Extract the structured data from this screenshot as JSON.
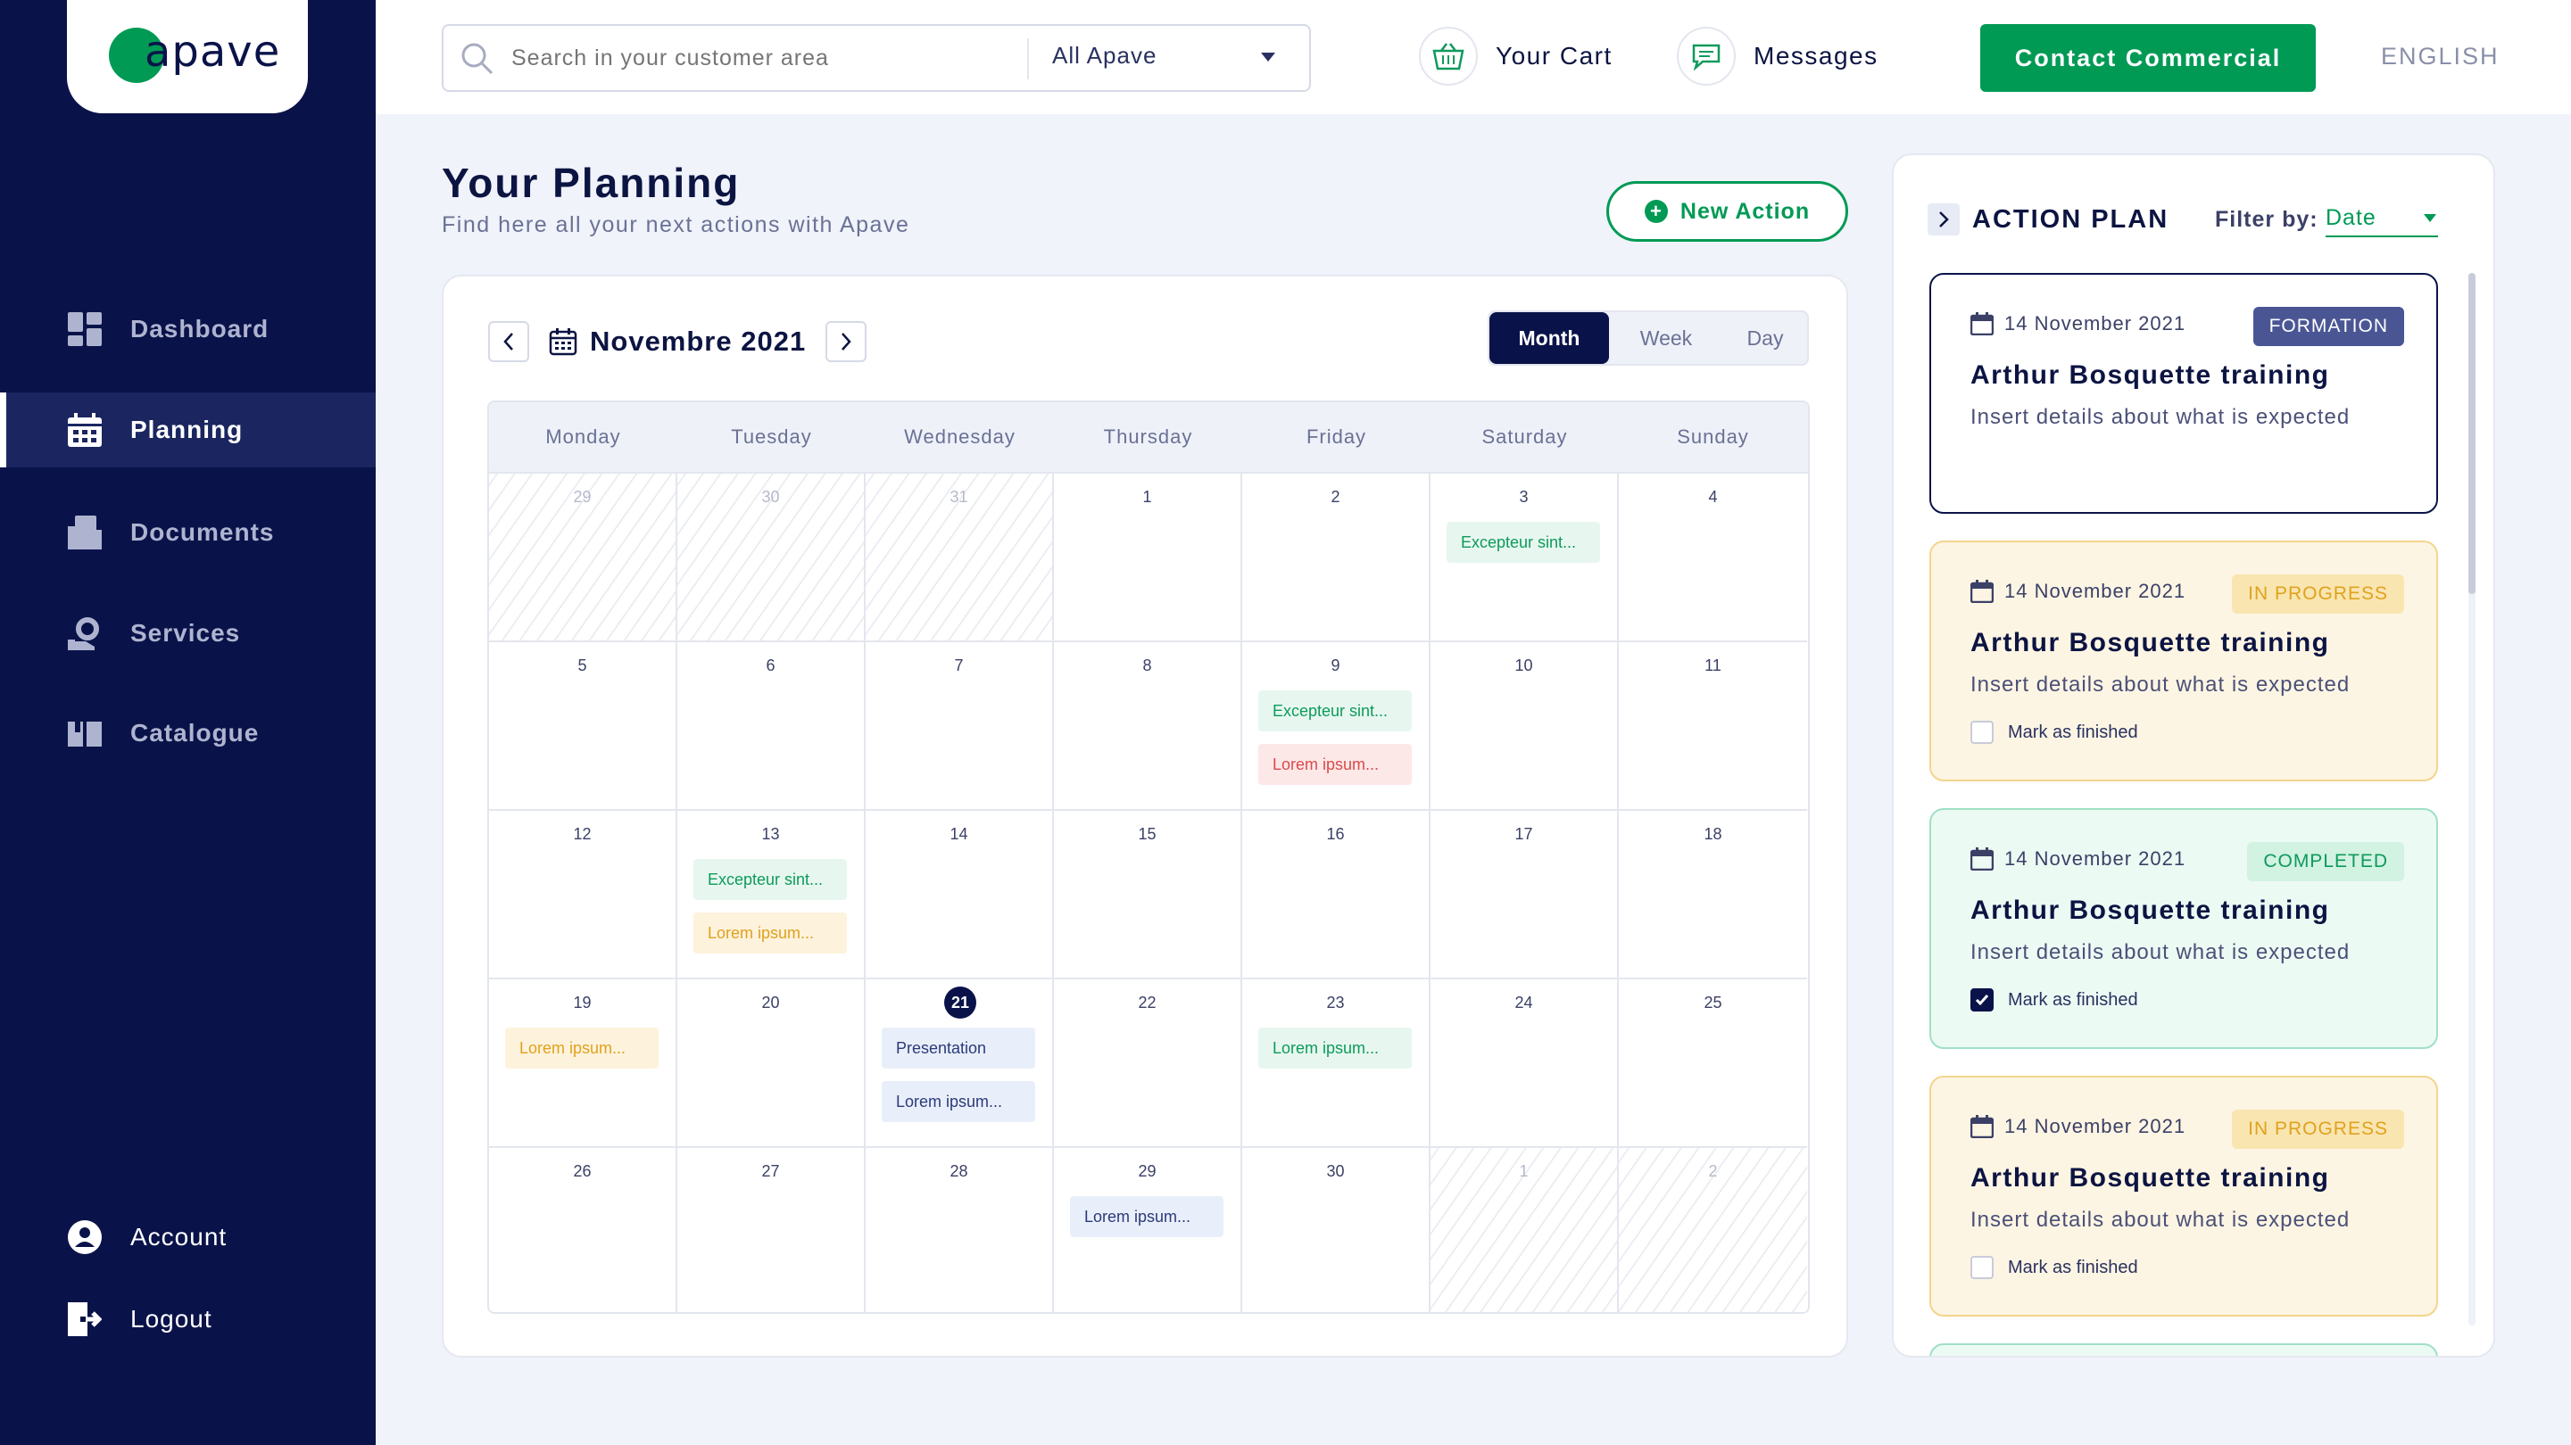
{
  "brand": {
    "logo_text": "apave"
  },
  "sidebar": {
    "items": [
      {
        "label": "Dashboard",
        "icon": "dashboard-icon"
      },
      {
        "label": "Planning",
        "icon": "calendar-icon"
      },
      {
        "label": "Documents",
        "icon": "documents-icon"
      },
      {
        "label": "Services",
        "icon": "services-icon"
      },
      {
        "label": "Catalogue",
        "icon": "catalogue-icon"
      }
    ],
    "active": "Planning",
    "bottom": [
      {
        "label": "Account",
        "icon": "account-icon"
      },
      {
        "label": "Logout",
        "icon": "logout-icon"
      }
    ]
  },
  "topbar": {
    "search_placeholder": "Search in your customer area",
    "scope_select": "All Apave",
    "cart_label": "Your Cart",
    "messages_label": "Messages",
    "contact_label": "Contact Commercial",
    "language": "ENGLISH"
  },
  "page": {
    "title": "Your Planning",
    "subtitle": "Find here all your next actions with Apave",
    "new_action": "New Action"
  },
  "calendar": {
    "month_label": "Novembre 2021",
    "views": [
      "Month",
      "Week",
      "Day"
    ],
    "active_view": "Month",
    "day_names": [
      "Monday",
      "Tuesday",
      "Wednesday",
      "Thursday",
      "Friday",
      "Saturday",
      "Sunday"
    ],
    "weeks": [
      [
        {
          "d": "29",
          "out": true
        },
        {
          "d": "30",
          "out": true
        },
        {
          "d": "31",
          "out": true
        },
        {
          "d": "1"
        },
        {
          "d": "2"
        },
        {
          "d": "3",
          "events": [
            {
              "t": "Excepteur sint...",
              "c": "green"
            }
          ]
        },
        {
          "d": "4"
        }
      ],
      [
        {
          "d": "5"
        },
        {
          "d": "6"
        },
        {
          "d": "7"
        },
        {
          "d": "8"
        },
        {
          "d": "9",
          "events": [
            {
              "t": "Excepteur sint...",
              "c": "green"
            },
            {
              "t": "Lorem ipsum...",
              "c": "red"
            }
          ]
        },
        {
          "d": "10"
        },
        {
          "d": "11"
        }
      ],
      [
        {
          "d": "12"
        },
        {
          "d": "13",
          "events": [
            {
              "t": "Excepteur sint...",
              "c": "green"
            },
            {
              "t": "Lorem ipsum...",
              "c": "yellow"
            }
          ]
        },
        {
          "d": "14"
        },
        {
          "d": "15"
        },
        {
          "d": "16"
        },
        {
          "d": "17"
        },
        {
          "d": "18"
        }
      ],
      [
        {
          "d": "19",
          "events": [
            {
              "t": "Lorem ipsum...",
              "c": "yellow"
            }
          ]
        },
        {
          "d": "20"
        },
        {
          "d": "21",
          "today": true,
          "events": [
            {
              "t": "Presentation",
              "c": "blue"
            },
            {
              "t": "Lorem ipsum...",
              "c": "blue"
            }
          ]
        },
        {
          "d": "22"
        },
        {
          "d": "23",
          "events": [
            {
              "t": "Lorem ipsum...",
              "c": "green"
            }
          ]
        },
        {
          "d": "24"
        },
        {
          "d": "25"
        }
      ],
      [
        {
          "d": "26"
        },
        {
          "d": "27"
        },
        {
          "d": "28"
        },
        {
          "d": "29",
          "events": [
            {
              "t": "Lorem ipsum...",
              "c": "blue"
            }
          ]
        },
        {
          "d": "30"
        },
        {
          "d": "1",
          "out": true
        },
        {
          "d": "2",
          "out": true
        }
      ]
    ]
  },
  "action_plan": {
    "title": "ACTION PLAN",
    "filter_label": "Filter by:",
    "filter_value": "Date",
    "mark_label": "Mark as finished",
    "items": [
      {
        "date": "14 November 2021",
        "badge": "FORMATION",
        "status": "formation",
        "name": "Arthur Bosquette training",
        "desc": "Insert details about what is expected",
        "checkable": false,
        "checked": false
      },
      {
        "date": "14 November 2021",
        "badge": "IN PROGRESS",
        "status": "progress",
        "name": "Arthur Bosquette training",
        "desc": "Insert details about what is expected",
        "checkable": true,
        "checked": false
      },
      {
        "date": "14 November 2021",
        "badge": "COMPLETED",
        "status": "done",
        "name": "Arthur Bosquette training",
        "desc": "Insert details about what is expected",
        "checkable": true,
        "checked": true
      },
      {
        "date": "14 November 2021",
        "badge": "IN PROGRESS",
        "status": "progress",
        "name": "Arthur Bosquette training",
        "desc": "Insert details about what is expected",
        "checkable": true,
        "checked": false
      }
    ]
  },
  "colors": {
    "navy": "#0a1349",
    "green": "#009a55",
    "background": "#f0f3fa"
  }
}
